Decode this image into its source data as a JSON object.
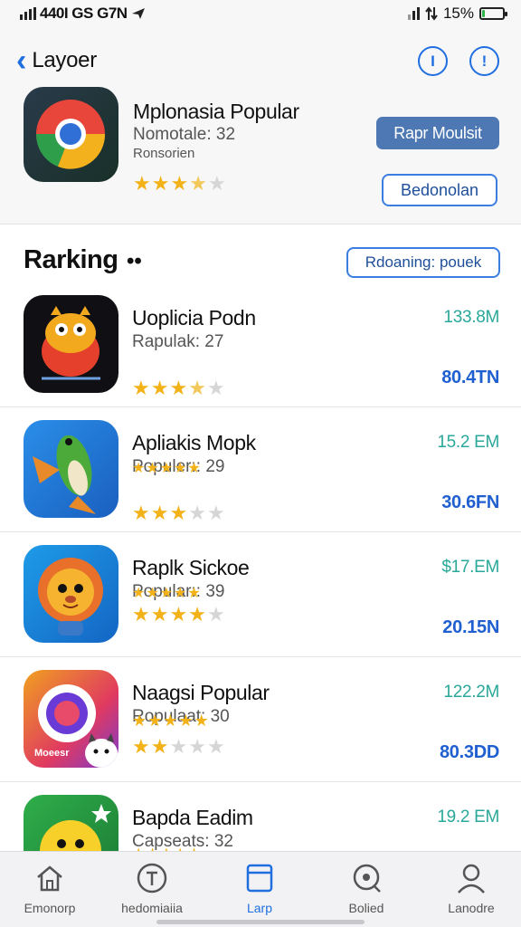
{
  "status": {
    "left_text": "440I GS G7N",
    "right_text": "15%",
    "battery_level": 0.15
  },
  "header": {
    "back_label": "Layoer",
    "icons": [
      "info-circle-icon",
      "alert-circle-icon"
    ],
    "featured": {
      "title": "Mplonasia Popular",
      "subtitle": "Nomotale: 32",
      "caption": "Ronsorien",
      "rating": 3.5,
      "primary_button": "Rapr Moulsit",
      "secondary_button": "Bedonolan"
    }
  },
  "section": {
    "title": "Rarking",
    "dots": "••",
    "button": "Rdoaning: pouek"
  },
  "apps": [
    {
      "name": "Uoplicia Podn",
      "subtitle": "Rapulak: 27",
      "size": "133.8M",
      "count": "80.4TN",
      "rating": 3.5,
      "small_rating": null,
      "icon": "orange-monster-icon"
    },
    {
      "name": "Apliakis Mopk",
      "subtitle": "Populer:: 29",
      "size": "15.2 EM",
      "count": "30.6FN",
      "rating": 3,
      "small_rating": 5,
      "icon": "green-bird-icon"
    },
    {
      "name": "Raplk Sickoe",
      "subtitle": "Popular:: 39",
      "size": "$17.EM",
      "count": "20.15N",
      "rating": 4,
      "small_rating": 5,
      "icon": "lion-cub-icon"
    },
    {
      "name": "Naagsi Popular",
      "subtitle": "Ropulaat: 30",
      "size": "122.2M",
      "count": "80.3DD",
      "rating": 2,
      "small_rating": 5,
      "icon": "camera-cat-icon",
      "icon_text": "Moeesr"
    },
    {
      "name": "Bapda Eadim",
      "subtitle": "Capseats: 32",
      "size": "19.2 EM",
      "count": "",
      "rating": 0,
      "small_rating": 5,
      "icon": "yellow-chick-icon"
    }
  ],
  "tabs": [
    {
      "label": "Emonorp",
      "icon": "home-icon",
      "active": false
    },
    {
      "label": "hedomiaiia",
      "icon": "t-circle-icon",
      "active": false
    },
    {
      "label": "Larp",
      "icon": "folder-icon",
      "active": true
    },
    {
      "label": "Bolied",
      "icon": "search-icon",
      "active": false
    },
    {
      "label": "Lanodre",
      "icon": "profile-icon",
      "active": false
    }
  ],
  "colors": {
    "accent": "#1f6fe0",
    "star": "#f2b218",
    "size_text": "#2aa89a",
    "count_text": "#1f5fd0",
    "primary_button": "#4d78b3"
  }
}
